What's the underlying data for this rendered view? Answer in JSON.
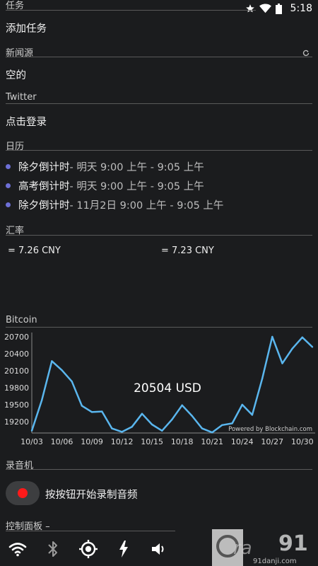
{
  "status_bar": {
    "time": "5:18"
  },
  "sections": {
    "tasks": {
      "title": "任务",
      "add_label": "添加任务"
    },
    "news": {
      "title": "新闻源",
      "empty_label": "空的"
    },
    "twitter": {
      "title": "Twitter",
      "login_label": "点击登录"
    },
    "calendar": {
      "title": "日历",
      "events": [
        {
          "title": "除夕倒计时",
          "time": " - 明天 9:00 上午 - 9:05 上午"
        },
        {
          "title": "高考倒计时",
          "time": " - 明天 9:00 上午 - 9:05 上午"
        },
        {
          "title": "除夕倒计时",
          "time": " - 11月2日 9:00 上午 - 9:05 上午"
        }
      ]
    },
    "exchange": {
      "title": "汇率",
      "values": [
        "= 7.26 CNY",
        "= 7.23 CNY"
      ]
    },
    "bitcoin": {
      "title": "Bitcoin",
      "price_label": "20504 USD",
      "powered_by": "Powered by Blockchain.com"
    },
    "recorder": {
      "title": "录音机",
      "hint": "按按钮开始录制音频"
    },
    "control_panel": {
      "title": "控制面板 –"
    }
  },
  "chart_data": {
    "type": "line",
    "x": [
      "10/03",
      "10/04",
      "10/05",
      "10/06",
      "10/07",
      "10/08",
      "10/09",
      "10/10",
      "10/11",
      "10/12",
      "10/13",
      "10/14",
      "10/15",
      "10/16",
      "10/17",
      "10/18",
      "10/19",
      "10/20",
      "10/21",
      "10/22",
      "10/23",
      "10/24",
      "10/25",
      "10/26",
      "10/27",
      "10/28",
      "10/29",
      "10/30",
      "10/31"
    ],
    "y": [
      19040,
      19580,
      20270,
      20110,
      19910,
      19480,
      19370,
      19380,
      19080,
      19020,
      19110,
      19340,
      19150,
      19040,
      19240,
      19490,
      19300,
      19080,
      19010,
      19140,
      19170,
      19500,
      19320,
      19960,
      20700,
      20230,
      20490,
      20690,
      20520
    ],
    "x_tick_labels": [
      "10/03",
      "10/06",
      "10/09",
      "10/12",
      "10/15",
      "10/18",
      "10/21",
      "10/24",
      "10/27",
      "10/30"
    ],
    "y_tick_labels": [
      "20700",
      "20400",
      "20100",
      "19800",
      "19500",
      "19200"
    ],
    "y_ticks": [
      20700,
      20400,
      20100,
      19800,
      19500,
      19200
    ],
    "ylim": [
      19000,
      20700
    ],
    "line_color": "#5ab6ee",
    "grid": false
  },
  "icons": [
    "star-icon",
    "wifi-icon",
    "battery-icon",
    "refresh-icon",
    "wifi-toggle-icon",
    "bluetooth-icon",
    "gps-icon",
    "flash-icon",
    "volume-icon"
  ]
}
